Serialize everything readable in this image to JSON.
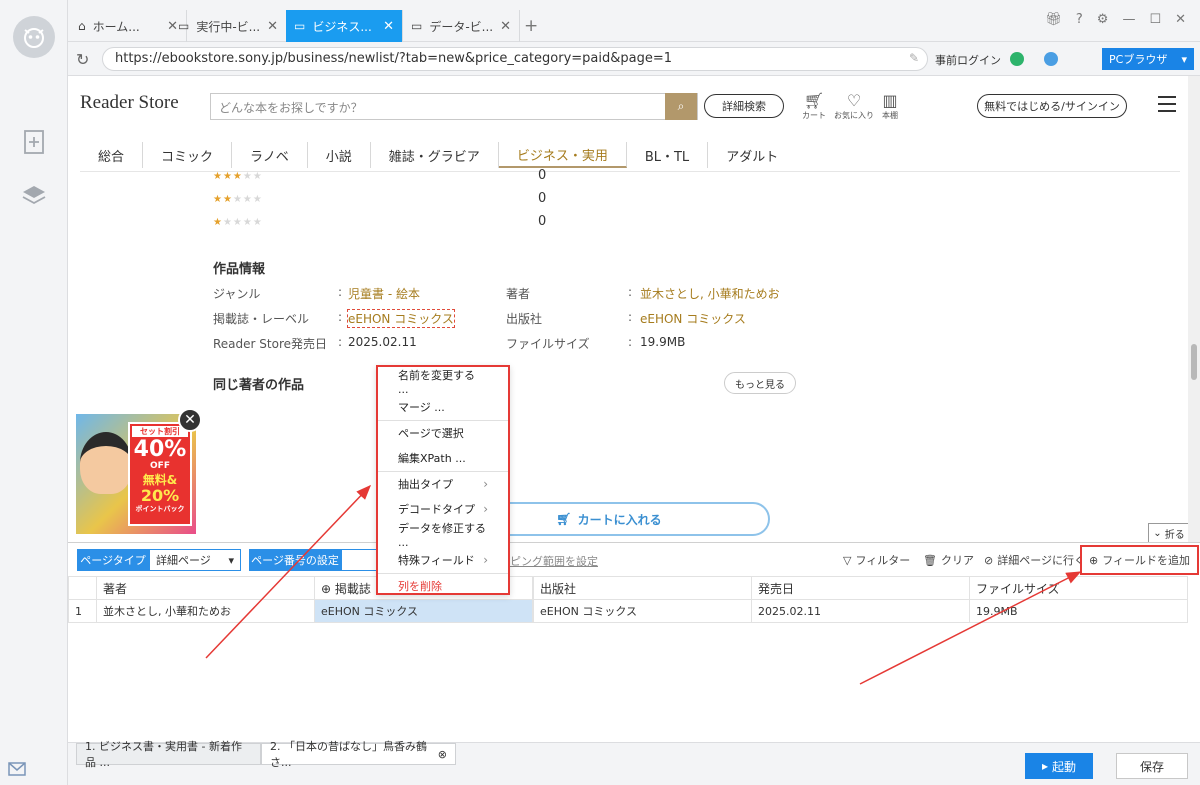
{
  "tabs": [
    {
      "label": "ホーム..."
    },
    {
      "label": "実行中-ビ..."
    },
    {
      "label": "ビジネス..."
    },
    {
      "label": "データ-ビ..."
    }
  ],
  "address": {
    "url": "https://ebookstore.sony.jp/business/newlist/?tab=new&price_category=paid&page=1",
    "login": "事前ログイン",
    "pc_browser": "PCブラウザ"
  },
  "site": {
    "logo": "Reader Store",
    "search_placeholder": "どんな本をお探しですか？",
    "detail_search": "詳細検索",
    "icons": {
      "cart": "カート",
      "favorite": "お気に入り",
      "shelf": "本棚"
    },
    "signup": "無料ではじめる/サインイン",
    "categories": [
      "総合",
      "コミック",
      "ラノベ",
      "小説",
      "雑誌・グラビア",
      "ビジネス・実用",
      "BL・TL",
      "アダルト"
    ]
  },
  "ratings": [
    {
      "stars": 3,
      "count": "0"
    },
    {
      "stars": 2,
      "count": "0"
    },
    {
      "stars": 1,
      "count": "0"
    }
  ],
  "work_info": {
    "title": "作品情報",
    "genre_label": "ジャンル",
    "genre": "児童書 - 絵本",
    "author_label": "著者",
    "author": "並木さとし, 小華和ためお",
    "label_label": "掲載誌・レーベル",
    "label": "eEHON コミックス",
    "publisher_label": "出版社",
    "publisher": "eEHON コミックス",
    "release_label": "Reader Store発売日",
    "release": "2025.02.11",
    "filesize_label": "ファイルサイズ",
    "filesize": "19.9MB",
    "same_author": "同じ著者の作品",
    "more": "もっと見る",
    "cart": "カートに入れる",
    "fold": "折る"
  },
  "ad": {
    "line1": "セット割引",
    "line2": "40%",
    "line3": "OFF",
    "line4": "無料&",
    "line5": "20%",
    "line6": "ポイントバック"
  },
  "panel": {
    "page_type_label": "ページタイプ",
    "page_type_value": "詳細ページ",
    "page_num_label": "ページ番号の設定",
    "scroll_link": "ピング範囲を設定",
    "filter": "フィルター",
    "clear": "クリア",
    "goto_detail": "詳細ページに行く",
    "add_field": "フィールドを追加",
    "columns": [
      "",
      "著者",
      "掲載誌",
      "",
      "出版社",
      "発売日",
      "ファイルサイズ"
    ],
    "rows": [
      [
        "1",
        "並木さとし, 小華和ためお",
        "eEHON コミックス",
        "",
        "eEHON コミックス",
        "2025.02.11",
        "19.9MB"
      ]
    ]
  },
  "context_menu": [
    {
      "label": "名前を変更する ...",
      "sub": false
    },
    {
      "label": "マージ ...",
      "sub": false
    },
    {
      "label": "ページで選択",
      "sub": false
    },
    {
      "label": "編集XPath ...",
      "sub": false
    },
    {
      "label": "抽出タイプ",
      "sub": true
    },
    {
      "label": "デコードタイプ",
      "sub": true
    },
    {
      "label": "データを修正する ...",
      "sub": false
    },
    {
      "label": "特殊フィールド",
      "sub": true
    },
    {
      "label": "列を削除",
      "sub": false
    }
  ],
  "bottom_tabs": [
    {
      "label": "1. ビジネス書・実用書 - 新着作品 ..."
    },
    {
      "label": "2. 「日本の昔ばなし」鳥香み鶴さ..."
    }
  ],
  "buttons": {
    "run": "起動",
    "save": "保存"
  },
  "colors": {
    "accent": "#1a84e6",
    "gold": "#a67c1e",
    "highlight_red": "#e53935"
  }
}
